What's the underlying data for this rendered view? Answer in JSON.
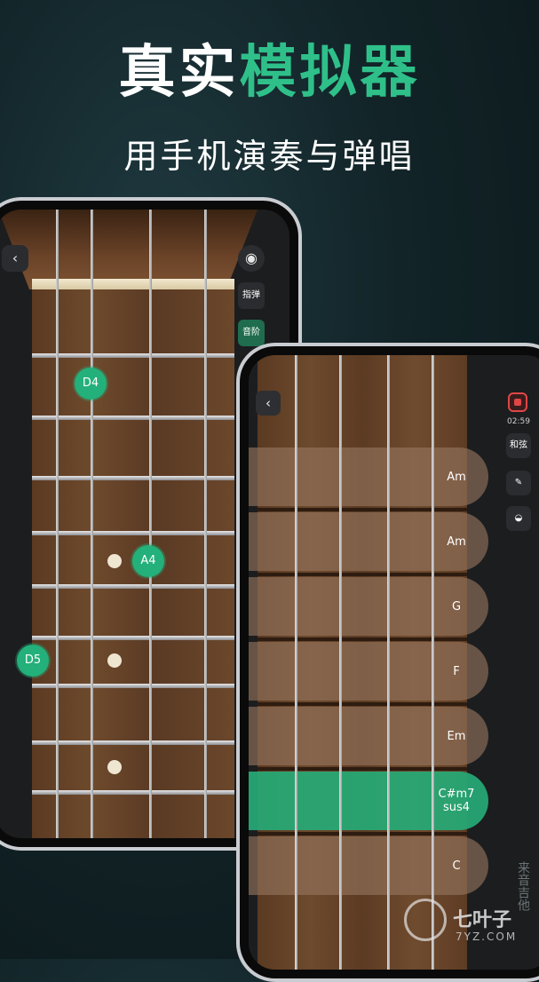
{
  "headline": {
    "part1": "真实",
    "part2": "模拟器"
  },
  "subline": "用手机演奏与弹唱",
  "phone_left": {
    "back_icon": "chevron-left-icon",
    "record_icon": "record-icon",
    "mode_button": "指弹",
    "scale_button": "音阶",
    "notes": [
      "D4",
      "A4",
      "D5"
    ]
  },
  "phone_right": {
    "back_icon": "chevron-left-icon",
    "timer": "02:59",
    "chord_button": "和弦",
    "edit_icon": "pencil-icon",
    "pick_icon": "guitar-pick-icon",
    "chords": [
      {
        "line1": "Am",
        "line2": "",
        "active": false
      },
      {
        "line1": "Am",
        "line2": "",
        "active": false
      },
      {
        "line1": "G",
        "line2": "",
        "active": false
      },
      {
        "line1": "F",
        "line2": "",
        "active": false
      },
      {
        "line1": "Em",
        "line2": "",
        "active": false
      },
      {
        "line1": "C#m7",
        "line2": "sus4",
        "active": true
      },
      {
        "line1": "C",
        "line2": "",
        "active": false
      }
    ]
  },
  "watermark": {
    "brand": "七叶子",
    "site": "7YZ.COM",
    "vertical": "来音吉他"
  },
  "colors": {
    "accent": "#2fc08a",
    "record_red": "#e04646"
  }
}
